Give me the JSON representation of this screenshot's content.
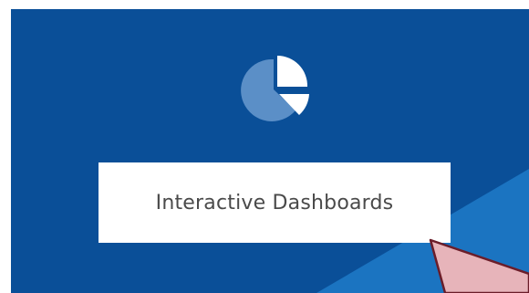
{
  "tile": {
    "label": "Interactive Dashboards",
    "icon": "pie-chart-icon",
    "colors": {
      "background": "#0a4f98",
      "accent_band": "#1b74c1",
      "icon_primary": "#ffffff",
      "icon_secondary": "#5b8fc7",
      "label_box": "#ffffff",
      "label_text": "#4a4a4a"
    }
  },
  "cursor": {
    "icon": "pointer-cursor-icon",
    "fill": "#e7b4ba",
    "stroke": "#6b1d2a"
  }
}
